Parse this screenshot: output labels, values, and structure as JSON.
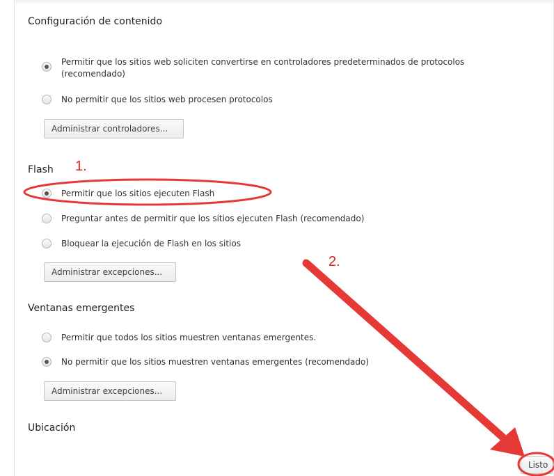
{
  "dialog": {
    "title": "Configuración de contenido"
  },
  "protocols": {
    "option_allow": "Permitir que los sitios web soliciten convertirse en controladores predeterminados de protocolos",
    "option_allow_note": "(recomendado)",
    "option_deny": "No permitir que los sitios web procesen protocolos",
    "manage_button": "Administrar controladores...",
    "selected": "allow"
  },
  "flash": {
    "heading": "Flash",
    "option_allow": "Permitir que los sitios ejecuten Flash",
    "option_ask": "Preguntar antes de permitir que los sitios ejecuten Flash (recomendado)",
    "option_block": "Bloquear la ejecución de Flash en los sitios",
    "manage_button": "Administrar excepciones...",
    "selected": "allow"
  },
  "popups": {
    "heading": "Ventanas emergentes",
    "option_allow": "Permitir que todos los sitios muestren ventanas emergentes.",
    "option_deny": "No permitir que los sitios muestren ventanas emergentes (recomendado)",
    "manage_button": "Administrar excepciones...",
    "selected": "deny"
  },
  "location": {
    "heading": "Ubicación"
  },
  "footer": {
    "done_button": "Listo"
  },
  "annotations": {
    "step1": "1.",
    "step2": "2.",
    "color": "#e53935"
  }
}
